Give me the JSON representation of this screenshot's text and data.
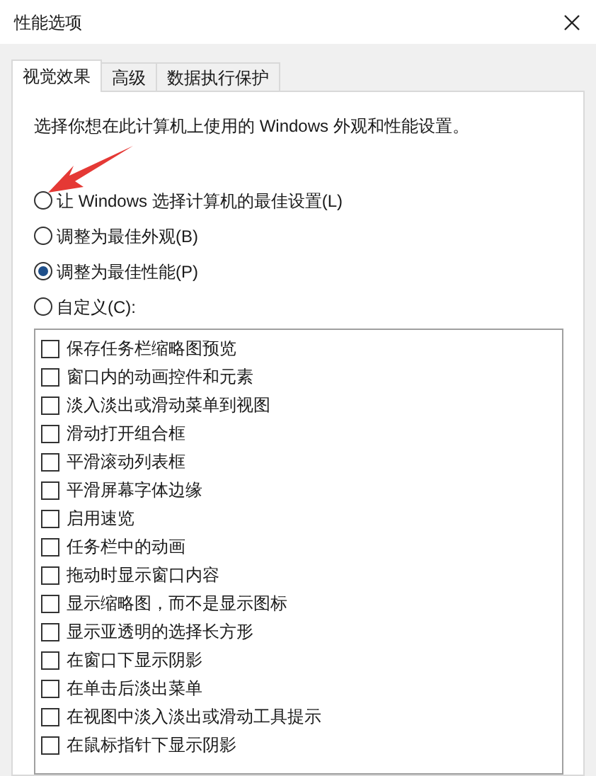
{
  "window": {
    "title": "性能选项"
  },
  "tabs": [
    {
      "label": "视觉效果",
      "selected": true
    },
    {
      "label": "高级",
      "selected": false
    },
    {
      "label": "数据执行保护",
      "selected": false
    }
  ],
  "description": "选择你想在此计算机上使用的 Windows 外观和性能设置。",
  "options": [
    {
      "label": "让 Windows 选择计算机的最佳设置(L)",
      "selected": false
    },
    {
      "label": "调整为最佳外观(B)",
      "selected": false
    },
    {
      "label": "调整为最佳性能(P)",
      "selected": true
    },
    {
      "label": "自定义(C):",
      "selected": false
    }
  ],
  "effects": [
    {
      "label": "保存任务栏缩略图预览",
      "checked": false
    },
    {
      "label": "窗口内的动画控件和元素",
      "checked": false
    },
    {
      "label": "淡入淡出或滑动菜单到视图",
      "checked": false
    },
    {
      "label": "滑动打开组合框",
      "checked": false
    },
    {
      "label": "平滑滚动列表框",
      "checked": false
    },
    {
      "label": "平滑屏幕字体边缘",
      "checked": false
    },
    {
      "label": "启用速览",
      "checked": false
    },
    {
      "label": "任务栏中的动画",
      "checked": false
    },
    {
      "label": "拖动时显示窗口内容",
      "checked": false
    },
    {
      "label": "显示缩略图，而不是显示图标",
      "checked": false
    },
    {
      "label": "显示亚透明的选择长方形",
      "checked": false
    },
    {
      "label": "在窗口下显示阴影",
      "checked": false
    },
    {
      "label": "在单击后淡出菜单",
      "checked": false
    },
    {
      "label": "在视图中淡入淡出或滑动工具提示",
      "checked": false
    },
    {
      "label": "在鼠标指针下显示阴影",
      "checked": false
    }
  ]
}
